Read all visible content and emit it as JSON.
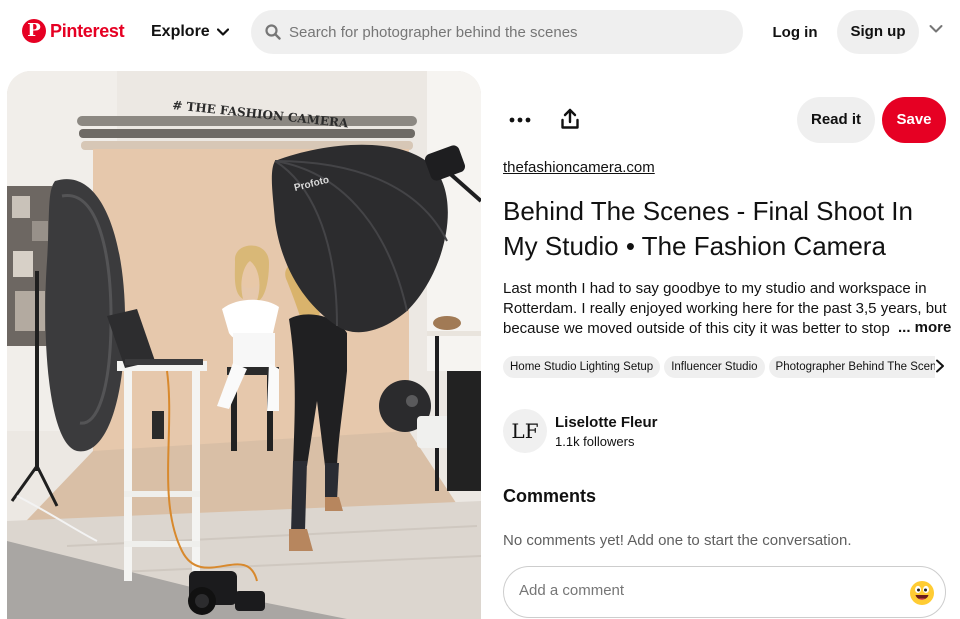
{
  "header": {
    "brand": "Pinterest",
    "explore_label": "Explore",
    "search_placeholder": "Search for photographer behind the scenes",
    "login_label": "Log in",
    "signup_label": "Sign up",
    "icons": [
      "pinterest-logo",
      "chevron-down-icon",
      "search-icon",
      "chevron-down-icon"
    ]
  },
  "photo": {
    "studio_sign": "# THE FASHION CAMERA",
    "softbox_brand": "Profoto"
  },
  "pin": {
    "more_icon": "ellipsis-icon",
    "share_icon": "upload-share-icon",
    "read_it_label": "Read it",
    "save_label": "Save",
    "source": "thefashioncamera.com",
    "title": "Behind The Scenes - Final Shoot In My Studio • The Fashion Camera",
    "description": "Last month I had to say goodbye to my studio and workspace in Rotterdam. I really enjoyed working here for the past 3,5 years, but because we moved outside of this city it was better to stop",
    "more_label": "... more",
    "tags": [
      "Home Studio Lighting Setup",
      "Influencer Studio",
      "Photographer Behind The Scenes"
    ]
  },
  "author": {
    "initials": "LF",
    "name": "Liselotte Fleur",
    "followers": "1.1k followers"
  },
  "comments": {
    "heading": "Comments",
    "empty_text": "No comments yet! Add one to start the conversation.",
    "input_placeholder": "Add a comment"
  },
  "colors": {
    "brand_red": "#e60023",
    "pill_gray": "#efefef",
    "text": "#111111"
  }
}
